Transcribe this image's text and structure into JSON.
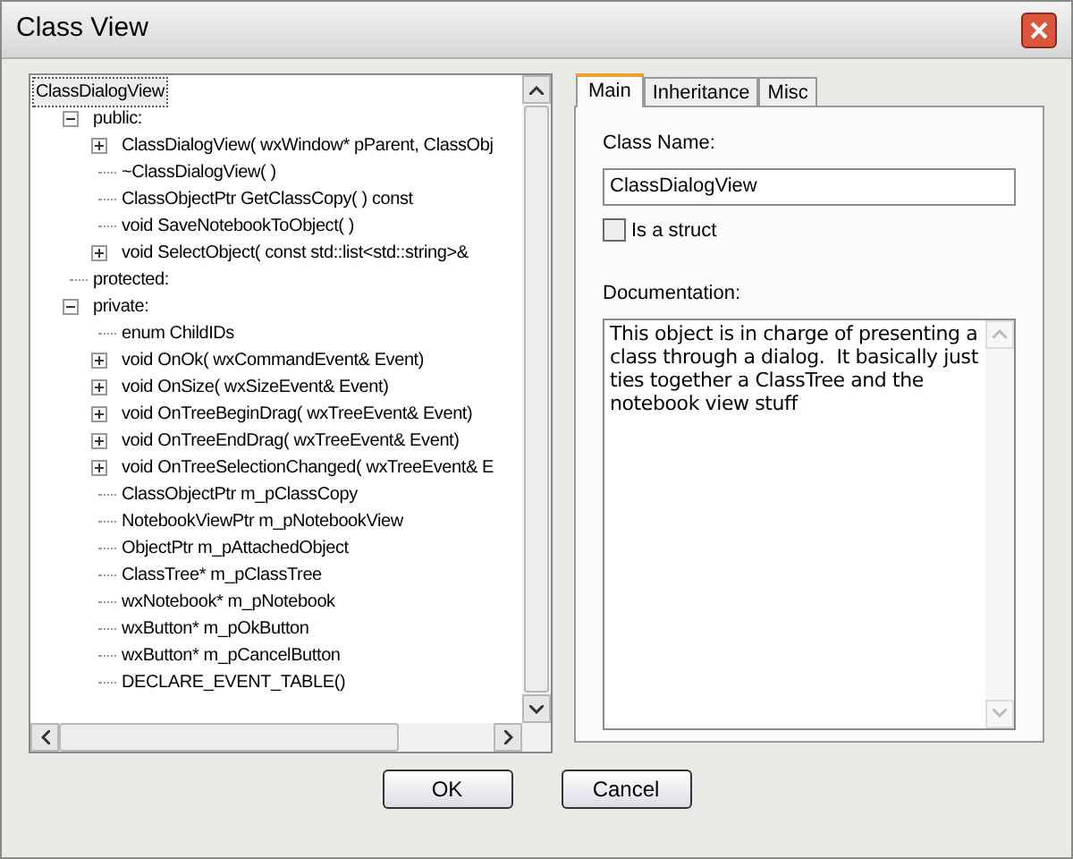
{
  "window": {
    "title": "Class View"
  },
  "tree": {
    "label": "ClassDialogView",
    "selected": true,
    "children": [
      {
        "label": "public:",
        "expanded": true,
        "children": [
          {
            "label": "ClassDialogView( wxWindow* pParent, ClassObj",
            "expanded": false
          },
          {
            "label": "~ClassDialogView( )"
          },
          {
            "label": "ClassObjectPtr GetClassCopy( ) const"
          },
          {
            "label": "void SaveNotebookToObject( )"
          },
          {
            "label": "void SelectObject( const std::list<std::string>&",
            "expanded": false
          }
        ]
      },
      {
        "label": "protected:"
      },
      {
        "label": "private:",
        "expanded": true,
        "children": [
          {
            "label": "enum ChildIDs"
          },
          {
            "label": "void OnOk( wxCommandEvent& Event)",
            "expanded": false
          },
          {
            "label": "void OnSize( wxSizeEvent& Event)",
            "expanded": false
          },
          {
            "label": "void OnTreeBeginDrag( wxTreeEvent& Event)",
            "expanded": false
          },
          {
            "label": "void OnTreeEndDrag( wxTreeEvent& Event)",
            "expanded": false
          },
          {
            "label": "void OnTreeSelectionChanged( wxTreeEvent& E",
            "expanded": false
          },
          {
            "label": "ClassObjectPtr m_pClassCopy"
          },
          {
            "label": "NotebookViewPtr m_pNotebookView"
          },
          {
            "label": "ObjectPtr m_pAttachedObject"
          },
          {
            "label": "ClassTree* m_pClassTree"
          },
          {
            "label": "wxNotebook* m_pNotebook"
          },
          {
            "label": "wxButton* m_pOkButton"
          },
          {
            "label": "wxButton* m_pCancelButton"
          },
          {
            "label": "DECLARE_EVENT_TABLE()"
          }
        ]
      }
    ]
  },
  "tabs": [
    {
      "label": "Main",
      "selected": true
    },
    {
      "label": "Inheritance",
      "selected": false
    },
    {
      "label": "Misc",
      "selected": false
    }
  ],
  "main": {
    "class_name_label": "Class Name:",
    "class_name": "ClassDialogView",
    "is_struct": {
      "label": "Is a struct",
      "checked": false
    },
    "documentation_label": "Documentation:",
    "documentation": "This object is in charge of presenting a class through a dialog.  It basically just ties together a ClassTree and the notebook view stuff"
  },
  "buttons": [
    "OK",
    "Cancel"
  ]
}
